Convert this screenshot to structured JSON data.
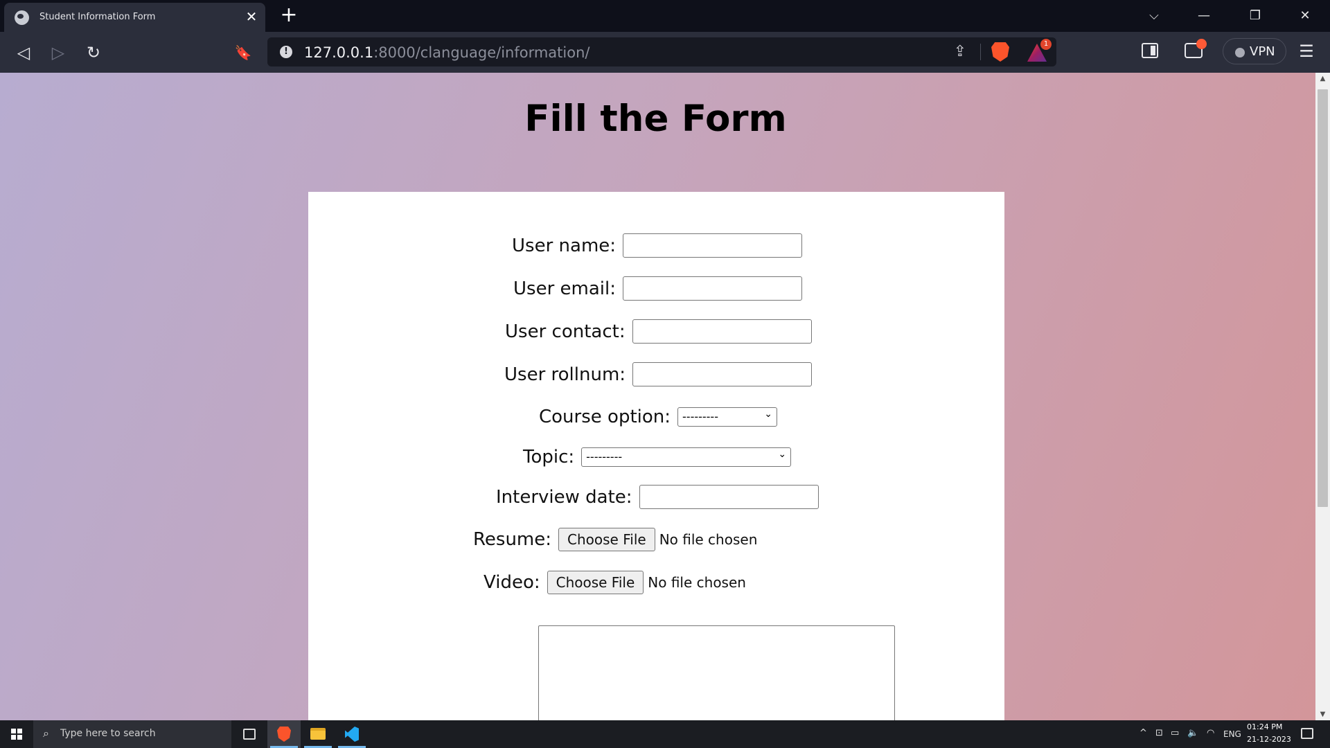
{
  "browser": {
    "tab": {
      "title": "Student Information Form",
      "close_glyph": "✕"
    },
    "new_tab_glyph": "+",
    "window_controls": {
      "tabs_dropdown": "⌵",
      "minimize": "—",
      "restore": "❐",
      "close": "✕"
    },
    "toolbar": {
      "back": "◁",
      "forward": "▷",
      "reload": "↻",
      "bookmark": "🔖",
      "menu": "☰"
    },
    "address": {
      "host": "127.0.0.1",
      "rest": ":8000/clanguage/information/",
      "info_glyph": "!"
    },
    "share_glyph": "⇪",
    "rewards_badge": "1",
    "vpn_label": "VPN"
  },
  "page": {
    "title": "Fill the Form",
    "form": {
      "username_label": "User name:",
      "email_label": "User email:",
      "contact_label": "User contact:",
      "rollnum_label": "User rollnum:",
      "course_label": "Course option:",
      "course_value": "---------",
      "topic_label": "Topic:",
      "topic_value": "---------",
      "interview_label": "Interview date:",
      "resume_label": "Resume:",
      "video_label": "Video:",
      "choose_file": "Choose File",
      "no_file": "No file chosen"
    }
  },
  "taskbar": {
    "search_placeholder": "Type here to search",
    "tray": {
      "up_arrow": "^",
      "lang": "ENG",
      "time": "01:24 PM",
      "date": "21-12-2023"
    }
  }
}
